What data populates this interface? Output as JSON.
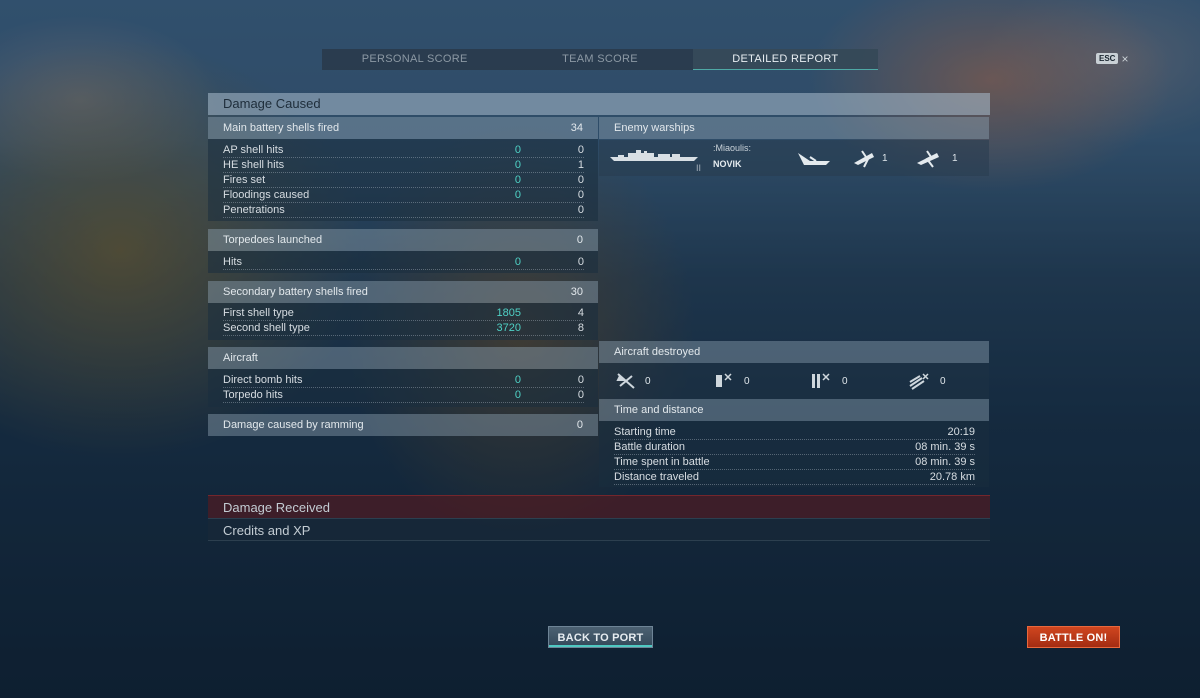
{
  "tabs": [
    {
      "label": "PERSONAL SCORE"
    },
    {
      "label": "TEAM SCORE"
    },
    {
      "label": "DETAILED REPORT"
    }
  ],
  "esc": {
    "key": "ESC",
    "close": "×"
  },
  "damage_caused": {
    "title": "Damage Caused",
    "main_battery": {
      "label": "Main battery shells fired",
      "value": "34",
      "rows": [
        {
          "label": "AP shell hits",
          "cyan": "0",
          "value": "0"
        },
        {
          "label": "HE shell hits",
          "cyan": "0",
          "value": "1"
        },
        {
          "label": "Fires set",
          "cyan": "0",
          "value": "0"
        },
        {
          "label": "Floodings caused",
          "cyan": "0",
          "value": "0"
        },
        {
          "label": "Penetrations",
          "cyan": "",
          "value": "0"
        }
      ]
    },
    "torpedoes": {
      "label": "Torpedoes launched",
      "value": "0",
      "rows": [
        {
          "label": "Hits",
          "cyan": "0",
          "value": "0"
        }
      ]
    },
    "secondary": {
      "label": "Secondary battery shells fired",
      "value": "30",
      "rows": [
        {
          "label": "First shell type",
          "cyan": "1805",
          "value": "4"
        },
        {
          "label": "Second shell type",
          "cyan": "3720",
          "value": "8"
        }
      ]
    },
    "aircraft": {
      "label": "Aircraft",
      "rows": [
        {
          "label": "Direct bomb hits",
          "cyan": "0",
          "value": "0"
        },
        {
          "label": "Torpedo hits",
          "cyan": "0",
          "value": "0"
        }
      ]
    },
    "ramming": {
      "label": "Damage caused by ramming",
      "value": "0"
    }
  },
  "enemy_warships": {
    "label": "Enemy warships",
    "ships": [
      {
        "tier": "II",
        "player": ":Miaoulis:",
        "name": "NOVIK",
        "icons": [
          "destroyed-icon",
          "citadel-icon",
          "damage-icon"
        ],
        "counts": [
          "",
          "1",
          "1"
        ]
      }
    ]
  },
  "aircraft_destroyed": {
    "label": "Aircraft destroyed",
    "items": [
      {
        "icon": "fighter-plane-icon",
        "count": "0"
      },
      {
        "icon": "bomber-plane-icon",
        "count": "0"
      },
      {
        "icon": "torpedo-plane-icon",
        "count": "0"
      },
      {
        "icon": "spotter-plane-icon",
        "count": "0"
      }
    ]
  },
  "time_distance": {
    "label": "Time and distance",
    "rows": [
      {
        "label": "Starting time",
        "value": "20:19"
      },
      {
        "label": "Battle duration",
        "value": "08 min. 39 s"
      },
      {
        "label": "Time spent in battle",
        "value": "08 min. 39 s"
      },
      {
        "label": "Distance traveled",
        "value": "20.78 km"
      }
    ]
  },
  "collapsed_sections": {
    "damage_received": "Damage Received",
    "credits_xp": "Credits and XP"
  },
  "buttons": {
    "back_to_port": "BACK TO PORT",
    "battle_on": "BATTLE ON!"
  },
  "colors": {
    "accent_cyan": "#4fd1c5",
    "battle_button": "#c23a18",
    "damage_received_bg": "#5a191e"
  }
}
